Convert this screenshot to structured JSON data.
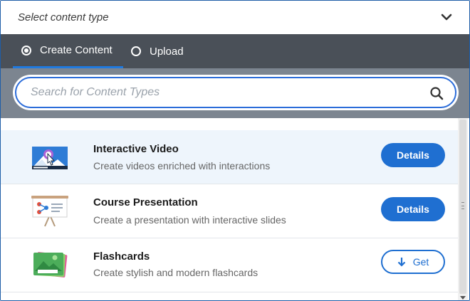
{
  "header": {
    "title": "Select content type",
    "chevron_icon": "chevron-down-icon"
  },
  "tabs": [
    {
      "label": "Create Content",
      "selected": true
    },
    {
      "label": "Upload",
      "selected": false
    }
  ],
  "search": {
    "placeholder": "Search for Content Types",
    "value": "",
    "icon": "search-icon"
  },
  "items": [
    {
      "name": "Interactive Video",
      "description": "Create videos enriched with interactions",
      "icon": "interactive-video-icon",
      "action_label": "Details",
      "action_type": "details"
    },
    {
      "name": "Course Presentation",
      "description": "Create a presentation with interactive slides",
      "icon": "course-presentation-icon",
      "action_label": "Details",
      "action_type": "details"
    },
    {
      "name": "Flashcards",
      "description": "Create stylish and modern flashcards",
      "icon": "flashcards-icon",
      "action_label": "Get",
      "action_type": "get"
    }
  ],
  "colors": {
    "accent": "#1f6fd1",
    "tab_bar": "#4a5058",
    "search_area": "#7c8590",
    "active_row": "#eef5fc"
  }
}
